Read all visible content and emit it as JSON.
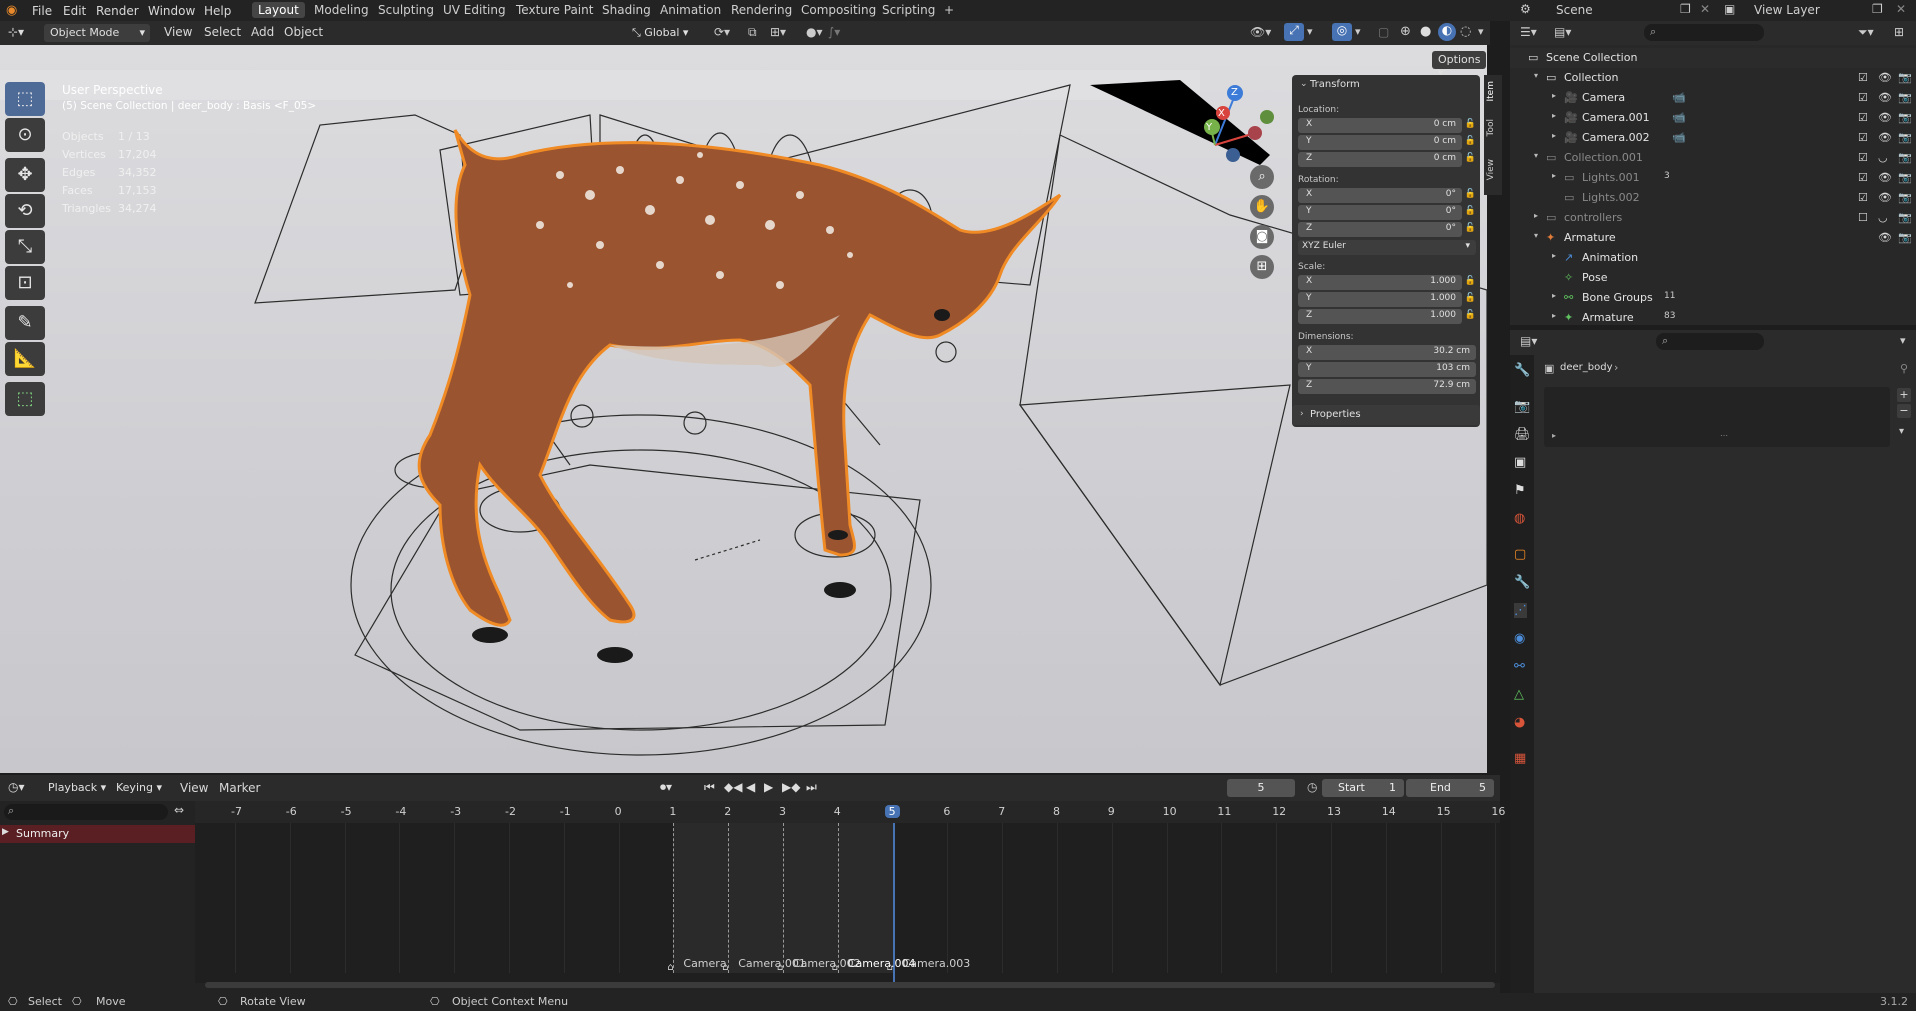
{
  "topbar": {
    "menus": [
      "File",
      "Edit",
      "Render",
      "Window",
      "Help"
    ],
    "workspaces": [
      "Layout",
      "Modeling",
      "Sculpting",
      "UV Editing",
      "Texture Paint",
      "Shading",
      "Animation",
      "Rendering",
      "Compositing",
      "Scripting"
    ],
    "active_workspace": "Layout",
    "add_tab": "+",
    "scene_label": "Scene",
    "view_layer_label": "View Layer"
  },
  "viewport_header": {
    "mode": "Object Mode",
    "menus": [
      "View",
      "Select",
      "Add",
      "Object"
    ],
    "orientation": "Global",
    "options": "Options"
  },
  "overlay": {
    "view_name": "User Perspective",
    "context": "(5) Scene Collection | deer_body : Basis <F_05>",
    "stats": [
      {
        "label": "Objects",
        "value": "1 / 13"
      },
      {
        "label": "Vertices",
        "value": "17,204"
      },
      {
        "label": "Edges",
        "value": "34,352"
      },
      {
        "label": "Faces",
        "value": "17,153"
      },
      {
        "label": "Triangles",
        "value": "34,274"
      }
    ]
  },
  "gizmo": {
    "x": "X",
    "y": "Y",
    "z": "Z"
  },
  "npanel": {
    "tabs": [
      "Item",
      "Tool",
      "View"
    ],
    "transform_title": "Transform",
    "location_label": "Location:",
    "location": [
      {
        "axis": "X",
        "value": "0 cm"
      },
      {
        "axis": "Y",
        "value": "0 cm"
      },
      {
        "axis": "Z",
        "value": "0 cm"
      }
    ],
    "rotation_label": "Rotation:",
    "rotation": [
      {
        "axis": "X",
        "value": "0°"
      },
      {
        "axis": "Y",
        "value": "0°"
      },
      {
        "axis": "Z",
        "value": "0°"
      }
    ],
    "rotation_mode": "XYZ Euler",
    "scale_label": "Scale:",
    "scale": [
      {
        "axis": "X",
        "value": "1.000"
      },
      {
        "axis": "Y",
        "value": "1.000"
      },
      {
        "axis": "Z",
        "value": "1.000"
      }
    ],
    "dimensions_label": "Dimensions:",
    "dimensions": [
      {
        "axis": "X",
        "value": "30.2 cm"
      },
      {
        "axis": "Y",
        "value": "103 cm"
      },
      {
        "axis": "Z",
        "value": "72.9 cm"
      }
    ],
    "properties_title": "Properties"
  },
  "outliner": {
    "rows": [
      {
        "name": "Scene Collection",
        "indent": 0,
        "icon": "collection-icon",
        "dim": false
      },
      {
        "name": "Collection",
        "indent": 1,
        "icon": "collection-icon",
        "dim": false
      },
      {
        "name": "Camera",
        "indent": 2,
        "icon": "camera-icon",
        "dim": false
      },
      {
        "name": "Camera.001",
        "indent": 2,
        "icon": "camera-icon",
        "dim": false
      },
      {
        "name": "Camera.002",
        "indent": 2,
        "icon": "camera-icon",
        "dim": false
      },
      {
        "name": "Collection.001",
        "indent": 1,
        "icon": "collection-icon",
        "dim": true
      },
      {
        "name": "Lights.001",
        "indent": 2,
        "icon": "collection-icon",
        "dim": true,
        "badge": "3"
      },
      {
        "name": "Lights.002",
        "indent": 2,
        "icon": "collection-icon",
        "dim": true
      },
      {
        "name": "controllers",
        "indent": 1,
        "icon": "collection-icon",
        "dim": true
      },
      {
        "name": "Armature",
        "indent": 1,
        "icon": "armature-icon",
        "dim": false
      },
      {
        "name": "Animation",
        "indent": 2,
        "icon": "animation-icon",
        "dim": false
      },
      {
        "name": "Pose",
        "indent": 2,
        "icon": "pose-icon",
        "dim": false
      },
      {
        "name": "Bone Groups",
        "indent": 2,
        "icon": "bone-groups-icon",
        "dim": false,
        "badge": "11"
      },
      {
        "name": "Armature",
        "indent": 2,
        "icon": "armature-data-icon",
        "dim": false,
        "badge": "83"
      }
    ]
  },
  "properties": {
    "breadcrumb": "deer_body",
    "breadcrumb_arrow": "›"
  },
  "timeline": {
    "menus": [
      "Playback",
      "Keying",
      "View",
      "Marker"
    ],
    "current_frame": "5",
    "start_label": "Start",
    "start": "1",
    "end_label": "End",
    "end": "5",
    "ticks": [
      "-7",
      "-6",
      "-5",
      "-4",
      "-3",
      "-2",
      "-1",
      "0",
      "1",
      "2",
      "3",
      "4",
      "5",
      "6",
      "7",
      "8",
      "9",
      "10",
      "11",
      "12",
      "13",
      "14",
      "15",
      "16"
    ],
    "summary": "Summary",
    "markers": [
      "Camera",
      "Camera.001",
      "Camera.002",
      "Camera.004",
      "Camera.003"
    ]
  },
  "statusbar": {
    "items": [
      "Select",
      "Move",
      "Rotate View",
      "Object Context Menu"
    ],
    "version": "3.1.2"
  },
  "colors": {
    "accent": "#4772b3",
    "selection_outline": "#f08a24",
    "summary_bg": "#5a1f22"
  }
}
